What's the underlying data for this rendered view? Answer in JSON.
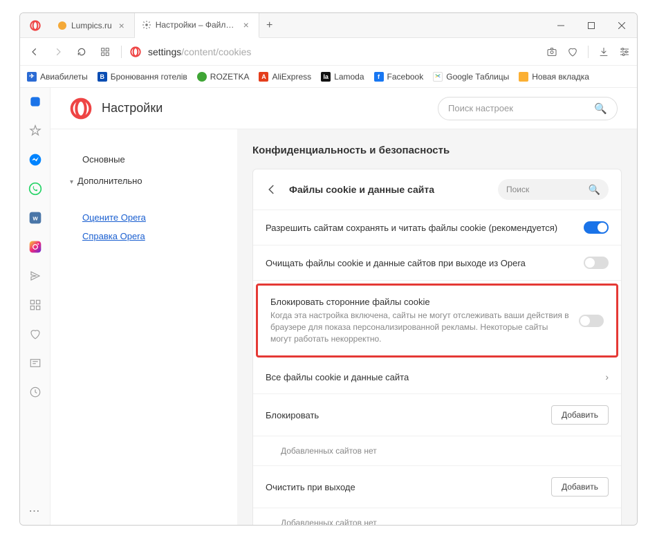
{
  "tabs": [
    {
      "label": "Lumpics.ru",
      "favicon_color": "#f4a938"
    },
    {
      "label": "Настройки – Файлы cookie",
      "favicon_type": "gear"
    }
  ],
  "url": {
    "prefix": "settings",
    "rest": "/content/cookies"
  },
  "bookmarks": [
    {
      "label": "Авиабилеты",
      "icon_bg": "#2b6bd4",
      "icon_txt": "✈"
    },
    {
      "label": "Бронювання готелів",
      "icon_bg": "#0b4db3",
      "icon_txt": "B"
    },
    {
      "label": "ROZETKA",
      "icon_bg": "#3fa535",
      "icon_txt": ""
    },
    {
      "label": "AliExpress",
      "icon_bg": "#e43e1c",
      "icon_txt": "A"
    },
    {
      "label": "Lamoda",
      "icon_bg": "#111",
      "icon_txt": "la"
    },
    {
      "label": "Facebook",
      "icon_bg": "#1877f2",
      "icon_txt": "f"
    },
    {
      "label": "Google Таблицы",
      "icon_bg": "#fff",
      "icon_txt": ""
    },
    {
      "label": "Новая вкладка",
      "icon_bg": "#fbb034",
      "icon_txt": ""
    }
  ],
  "settings": {
    "title": "Настройки",
    "search_placeholder": "Поиск настроек",
    "nav": {
      "basic": "Основные",
      "advanced": "Дополнительно",
      "rate": "Оцените Opera",
      "help": "Справка Opera"
    },
    "section_title": "Конфиденциальность и безопасность",
    "card": {
      "title": "Файлы cookie и данные сайта",
      "search_placeholder": "Поиск"
    },
    "rows": {
      "allow_cookies": "Разрешить сайтам сохранять и читать файлы cookie (рекомендуется)",
      "clear_on_exit": "Очищать файлы cookie и данные сайтов при выходе из Opera",
      "block_third_party": {
        "title": "Блокировать сторонние файлы cookie",
        "desc": "Когда эта настройка включена, сайты не могут отслеживать ваши действия в браузере для показа персонализированной рекламы. Некоторые сайты могут работать некорректно."
      },
      "all_cookies": "Все файлы cookie и данные сайта",
      "block_section": "Блокировать",
      "clear_exit_section": "Очистить при выходе",
      "no_sites": "Добавленных сайтов нет",
      "add_button": "Добавить"
    }
  }
}
